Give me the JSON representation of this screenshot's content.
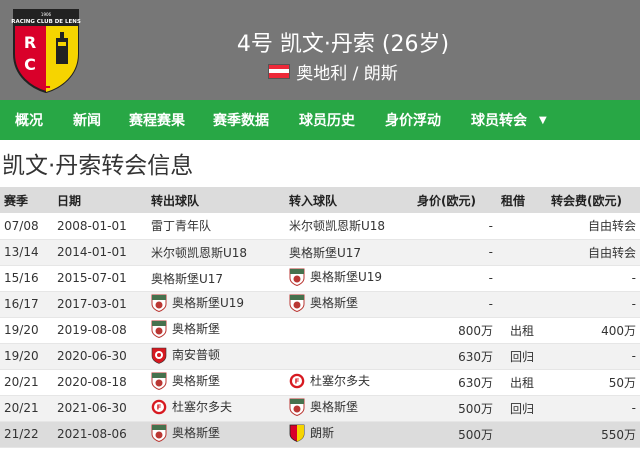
{
  "header": {
    "title": "4号 凯文·丹索 (26岁)",
    "nation": "奥地利 / 朗斯",
    "flag_colors": [
      "#ed2939",
      "#ffffff",
      "#ed2939"
    ],
    "crest_text": "RACING CLUB DE LENS",
    "crest_year": "1906",
    "crest_letters": [
      "R",
      "C",
      "L"
    ]
  },
  "nav": {
    "items": [
      "概况",
      "新闻",
      "赛程赛果",
      "赛季数据",
      "球员历史",
      "身价浮动",
      "球员转会"
    ],
    "bg_color": "#28a745"
  },
  "page": {
    "title": "凯文·丹索转会信息"
  },
  "table": {
    "headers": [
      "赛季",
      "日期",
      "转出球队",
      "转入球队",
      "身价(欧元)",
      "租借",
      "转会费(欧元)"
    ],
    "rows": [
      {
        "season": "07/08",
        "date": "2008-01-01",
        "from": "雷丁青年队",
        "from_logo": "",
        "to": "米尔顿凯恩斯U18",
        "to_logo": "",
        "value": "-",
        "loan": "",
        "fee": "自由转会"
      },
      {
        "season": "13/14",
        "date": "2014-01-01",
        "from": "米尔顿凯恩斯U18",
        "from_logo": "",
        "to": "奥格斯堡U17",
        "to_logo": "",
        "value": "-",
        "loan": "",
        "fee": "自由转会"
      },
      {
        "season": "15/16",
        "date": "2015-07-01",
        "from": "奥格斯堡U17",
        "from_logo": "",
        "to": "奥格斯堡U19",
        "to_logo": "augsburg",
        "value": "-",
        "loan": "",
        "fee": "-"
      },
      {
        "season": "16/17",
        "date": "2017-03-01",
        "from": "奥格斯堡U19",
        "from_logo": "augsburg",
        "to": "奥格斯堡",
        "to_logo": "augsburg",
        "value": "-",
        "loan": "",
        "fee": "-"
      },
      {
        "season": "19/20",
        "date": "2019-08-08",
        "from": "奥格斯堡",
        "from_logo": "augsburg",
        "to": "",
        "to_logo": "",
        "value": "800万",
        "loan": "出租",
        "fee": "400万"
      },
      {
        "season": "19/20",
        "date": "2020-06-30",
        "from": "南安普顿",
        "from_logo": "southampton",
        "to": "",
        "to_logo": "",
        "value": "630万",
        "loan": "回归",
        "fee": "-"
      },
      {
        "season": "20/21",
        "date": "2020-08-18",
        "from": "奥格斯堡",
        "from_logo": "augsburg",
        "to": "杜塞尔多夫",
        "to_logo": "fortuna",
        "value": "630万",
        "loan": "出租",
        "fee": "50万"
      },
      {
        "season": "20/21",
        "date": "2021-06-30",
        "from": "杜塞尔多夫",
        "from_logo": "fortuna",
        "to": "奥格斯堡",
        "to_logo": "augsburg",
        "value": "500万",
        "loan": "回归",
        "fee": "-"
      },
      {
        "season": "21/22",
        "date": "2021-08-06",
        "from": "奥格斯堡",
        "from_logo": "augsburg",
        "to": "朗斯",
        "to_logo": "lens",
        "value": "500万",
        "loan": "",
        "fee": "550万"
      }
    ]
  }
}
